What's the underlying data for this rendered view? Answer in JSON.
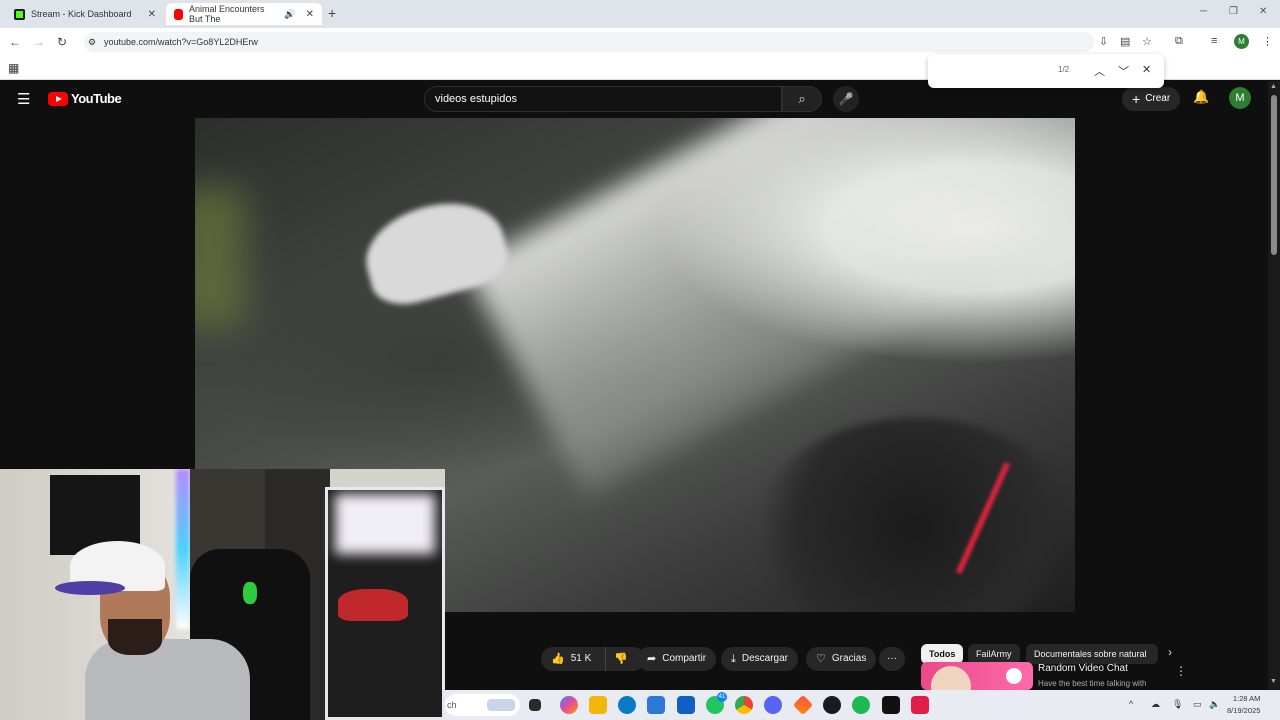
{
  "browser": {
    "tabs": [
      {
        "title": "Stream - Kick Dashboard",
        "close": "✕"
      },
      {
        "title": "Animal Encounters But The",
        "close": "✕"
      }
    ],
    "new_tab": "+",
    "window_controls": {
      "minimize": "─",
      "maximize": "❐",
      "close": "✕"
    },
    "nav": {
      "back": "←",
      "forward": "→",
      "reload": "↻"
    },
    "url": "youtube.com/watch?v=Go8YL2DHErw",
    "profile_initial": "M",
    "find": {
      "count": "1/2",
      "prev": "︿",
      "next": "﹀",
      "close": "✕"
    }
  },
  "youtube": {
    "logo_text": "YouTube",
    "search_value": "videos estupidos",
    "create_label": "Crear",
    "avatar_initial": "M",
    "actions": {
      "likes": "51 K",
      "share": "Compartir",
      "download": "Descargar",
      "thanks": "Gracias",
      "more": "···"
    },
    "chips": [
      "Todos",
      "FailArmy",
      "Documentales sobre natural"
    ],
    "recommendation": {
      "title": "Random Video Chat",
      "subtitle": "Have the best time talking with"
    }
  },
  "taskbar": {
    "search_text": "ch",
    "notification_badge": "41",
    "time": "1:28 AM",
    "date": "8/19/2025"
  }
}
